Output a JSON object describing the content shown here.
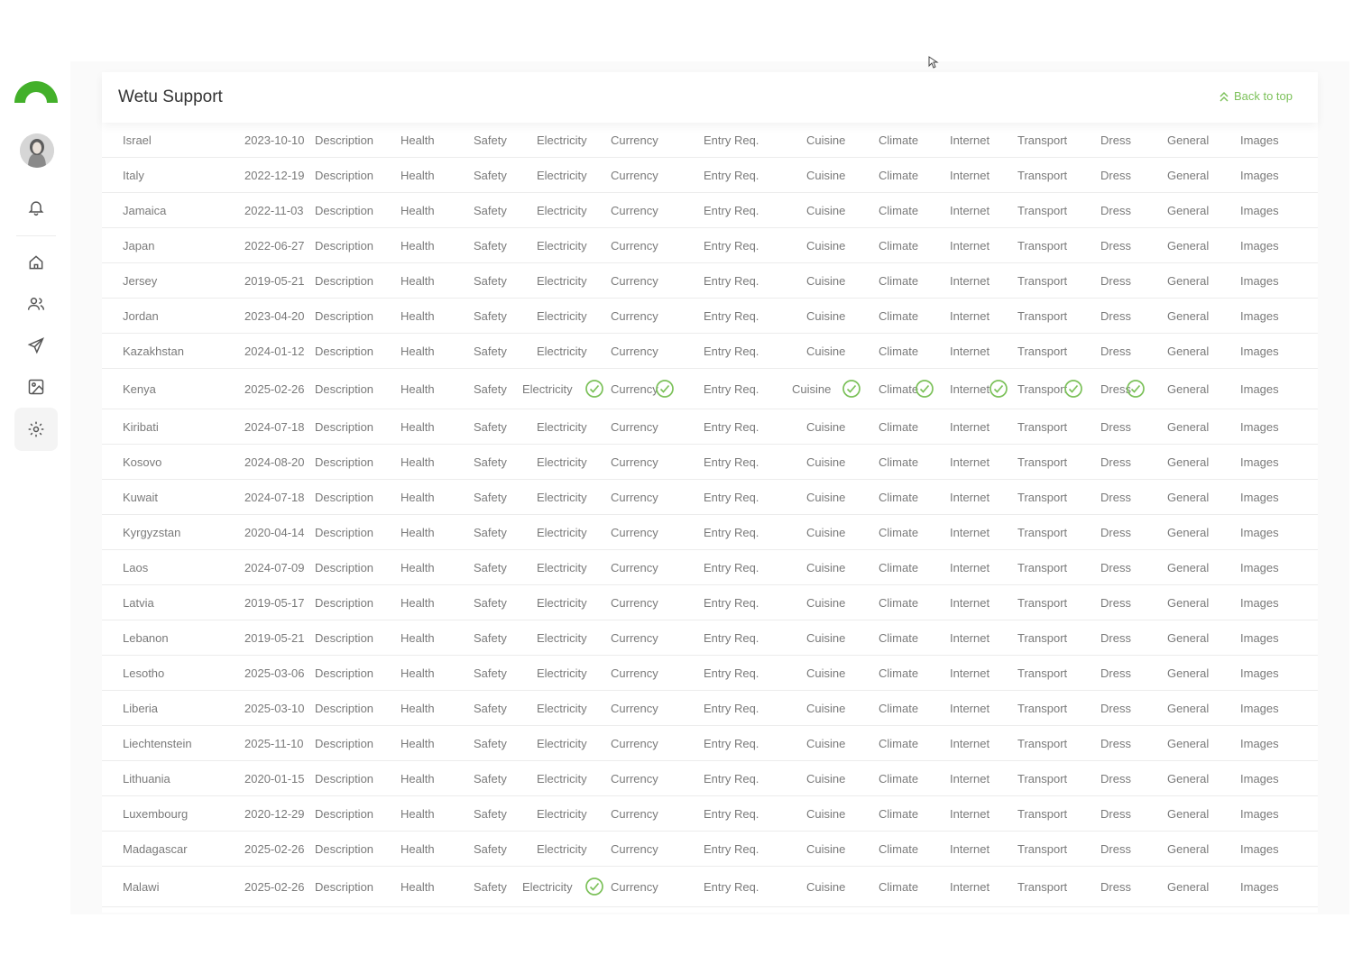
{
  "app": {
    "title": "Wetu Support",
    "back_to_top": "Back to top",
    "accent": "#7cc15a"
  },
  "sidebar": {
    "icons": [
      "logo-arc-icon",
      "avatar",
      "bell-icon",
      "home-icon",
      "users-icon",
      "send-icon",
      "image-icon",
      "gear-icon"
    ]
  },
  "columns": [
    "Description",
    "Health",
    "Safety",
    "Electricity",
    "Currency",
    "Entry Req.",
    "Cuisine",
    "Climate",
    "Internet",
    "Transport",
    "Dress",
    "General",
    "Images"
  ],
  "rows": [
    {
      "country": "Israel",
      "date": "2023-10-10"
    },
    {
      "country": "Italy",
      "date": "2022-12-19"
    },
    {
      "country": "Jamaica",
      "date": "2022-11-03"
    },
    {
      "country": "Japan",
      "date": "2022-06-27"
    },
    {
      "country": "Jersey",
      "date": "2019-05-21"
    },
    {
      "country": "Jordan",
      "date": "2023-04-20"
    },
    {
      "country": "Kazakhstan",
      "date": "2024-01-12"
    },
    {
      "country": "Kenya",
      "date": "2025-02-26",
      "checks": [
        "Electricity",
        "Currency",
        "Cuisine",
        "Climate",
        "Internet",
        "Transport",
        "Dress"
      ]
    },
    {
      "country": "Kiribati",
      "date": "2024-07-18"
    },
    {
      "country": "Kosovo",
      "date": "2024-08-20"
    },
    {
      "country": "Kuwait",
      "date": "2024-07-18"
    },
    {
      "country": "Kyrgyzstan",
      "date": "2020-04-14"
    },
    {
      "country": "Laos",
      "date": "2024-07-09"
    },
    {
      "country": "Latvia",
      "date": "2019-05-17"
    },
    {
      "country": "Lebanon",
      "date": "2019-05-21"
    },
    {
      "country": "Lesotho",
      "date": "2025-03-06"
    },
    {
      "country": "Liberia",
      "date": "2025-03-10"
    },
    {
      "country": "Liechtenstein",
      "date": "2025-11-10"
    },
    {
      "country": "Lithuania",
      "date": "2020-01-15"
    },
    {
      "country": "Luxembourg",
      "date": "2020-12-29"
    },
    {
      "country": "Madagascar",
      "date": "2025-02-26"
    },
    {
      "country": "Malawi",
      "date": "2025-02-26",
      "checks": [
        "Electricity"
      ]
    }
  ]
}
